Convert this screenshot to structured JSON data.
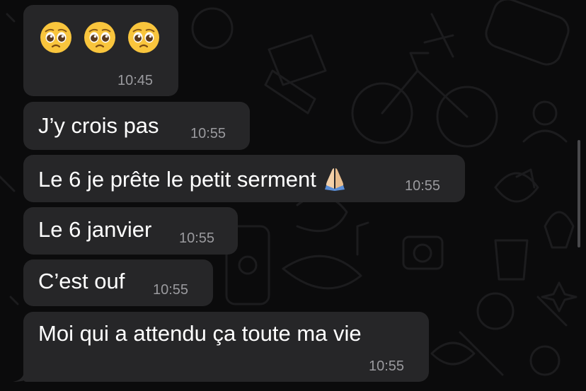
{
  "wallpaper": {
    "icon": "doodle-pattern",
    "line_color": "#1c1c1e",
    "background": "#0b0b0c"
  },
  "bubble_color": "#262628",
  "messages": [
    {
      "text": "",
      "emojis": [
        "pleading-face",
        "pleading-face",
        "pleading-face"
      ],
      "time": "10:45"
    },
    {
      "text": "J’y crois pas",
      "time": "10:55"
    },
    {
      "text": "Le 6 je prête le petit serment",
      "emoji": "folded-hands",
      "time": "10:55"
    },
    {
      "text": "Le 6 janvier",
      "time": "10:55"
    },
    {
      "text": "C’est ouf",
      "time": "10:55"
    },
    {
      "text": "Moi qui a attendu ça toute ma vie",
      "time": "10:55"
    }
  ]
}
